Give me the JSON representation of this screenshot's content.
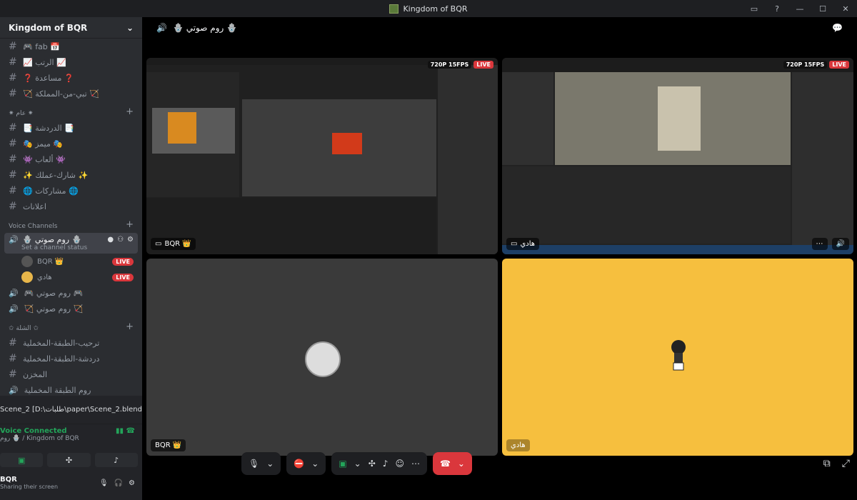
{
  "window": {
    "title": "Kingdom of BQR"
  },
  "sidebar": {
    "server_name": "Kingdom of BQR",
    "top_channels": [
      {
        "label": "🎮 fab 📅"
      },
      {
        "label": "📈 الرتب 📈"
      },
      {
        "label": "❓ مساعدة ❓"
      },
      {
        "label": "🏹 تبي-من-المملكة 🏹"
      }
    ],
    "category_general": "✷ عام ✷",
    "general_channels": [
      {
        "label": "📑 الدردشة 📑"
      },
      {
        "label": "🎭 ميمز 🎭"
      },
      {
        "label": "👾 ألعاب 👾"
      },
      {
        "label": "✨ شارك-عملك ✨"
      },
      {
        "label": "🌐 مشاركات 🌐"
      },
      {
        "label": "اعلانات"
      }
    ],
    "voice_category": "Voice Channels",
    "active_voice": {
      "label": "🪬 روم صوتي 🪬",
      "status": "Set a channel status"
    },
    "voice_users": [
      {
        "name": "BQR 👑",
        "badge": "LIVE"
      },
      {
        "name": "هادي",
        "badge": "LIVE"
      }
    ],
    "other_voice": [
      {
        "label": "🎮 روم صوتي 🎮"
      },
      {
        "label": "🏹 روم صوتي 🏹"
      }
    ],
    "category_class": "✩ الشلة ✩",
    "class_channels": [
      {
        "label": "ترحيب-الطبقة-المخملية"
      },
      {
        "label": "دردشة-الطبقة-المخملية"
      },
      {
        "label": "المخزن"
      },
      {
        "label": "روم الطبقة المخملية"
      }
    ]
  },
  "panel": {
    "stream_title": "Scene_2 [D:\\طلبات\\paper\\Scene_2.blend]...",
    "connected": "Voice Connected",
    "location": "روم 🪬 / Kingdom of BQR",
    "user_name": "BQR",
    "user_status": "Sharing their screen"
  },
  "main": {
    "channel_title": "🪬 روم صوتي 🪬",
    "tiles": [
      {
        "name": "BQR 👑",
        "quality": "720P 15FPS",
        "live": "LIVE"
      },
      {
        "name": "هادي",
        "quality": "720P 15FPS",
        "live": "LIVE"
      },
      {
        "name": "BQR 👑"
      },
      {
        "name": "هادي"
      }
    ]
  }
}
